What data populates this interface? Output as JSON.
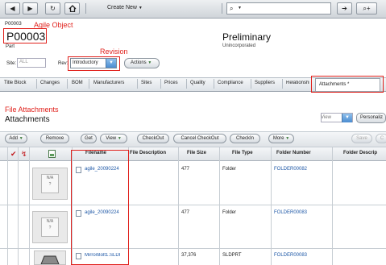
{
  "toolbar": {
    "back_icon": "triangle-left",
    "forward_icon": "triangle-right",
    "refresh_icon": "refresh",
    "home_icon": "home",
    "create_new_label": "Create New",
    "search_icon": "magnifier",
    "go_icon": "arrow-right",
    "advanced_search_icon": "search-plus"
  },
  "header": {
    "object_id_small": "P00003",
    "annotation_object": "Agile Object",
    "object_number": "P00003",
    "object_type": "Part",
    "status": "Preliminary",
    "substatus": "Unincorporated",
    "annotation_revision": "Revision",
    "site_label": "Site:",
    "site_value": "ALL",
    "rev_label": "Rev:",
    "rev_value": "Introductory",
    "actions_label": "Actions"
  },
  "tabs": [
    "Title Block",
    "Changes",
    "BOM",
    "Manufacturers",
    "Sites",
    "Prices",
    "Quality",
    "Compliance",
    "Suppliers",
    "Relationships",
    "Attachments"
  ],
  "active_tab_marker": "*",
  "section": {
    "annotation_file_attachments": "File Attachments",
    "title": "Attachments",
    "view_label": "View",
    "personalize_label": "Personaliz"
  },
  "action_buttons": {
    "add": "Add",
    "remove": "Remove",
    "get": "Get",
    "view": "View",
    "checkout": "CheckOut",
    "cancel_checkout": "Cancel CheckOut",
    "checkin": "CheckIn",
    "more": "More",
    "save": "Save",
    "cancel": "C"
  },
  "table": {
    "columns": [
      "Filename",
      "File Description",
      "File Size",
      "File Type",
      "Folder Number",
      "Folder Descrip"
    ],
    "thumbnail_placeholder": "N/A",
    "rows": [
      {
        "filename": "agile_20090224",
        "description": "",
        "size": "477",
        "type": "Folder",
        "folder_number": "FOLDER00082"
      },
      {
        "filename": "agile_20090224",
        "description": "",
        "size": "477",
        "type": "Folder",
        "folder_number": "FOLDER00083"
      },
      {
        "filename": "MirrorBolt1.SLDI",
        "description": "",
        "size": "37,376",
        "type": "SLDPRT",
        "folder_number": "FOLDER00083"
      }
    ]
  },
  "colors": {
    "annotation_red": "#e0201b",
    "link_blue": "#1d57a6",
    "dropdown_blue": "#4a8cd0"
  }
}
